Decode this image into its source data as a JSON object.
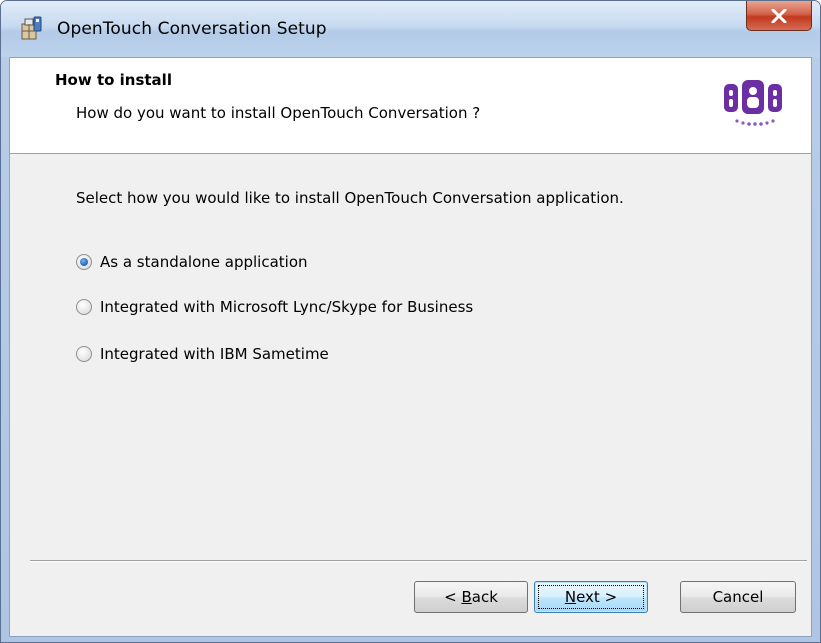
{
  "window": {
    "title": "OpenTouch Conversation Setup",
    "close_label": "X"
  },
  "banner": {
    "title": "How to install",
    "subtitle": "How do you want to install OpenTouch Conversation ?"
  },
  "content": {
    "instruction": "Select how you would like to install OpenTouch Conversation application.",
    "options": [
      {
        "label": "As a standalone application",
        "selected": true
      },
      {
        "label": "Integrated with Microsoft Lync/Skype for Business",
        "selected": false
      },
      {
        "label": "Integrated with IBM Sametime",
        "selected": false
      }
    ]
  },
  "buttons": {
    "back": {
      "pre": "< ",
      "accel": "B",
      "post": "ack"
    },
    "next": {
      "accel": "N",
      "post": "ext >"
    },
    "cancel": "Cancel"
  },
  "colors": {
    "logo_purple": "#6b2fa3",
    "client_bg": "#f0f0f0",
    "title_bar": "#c7daf0",
    "close_red": "#c2391d"
  }
}
